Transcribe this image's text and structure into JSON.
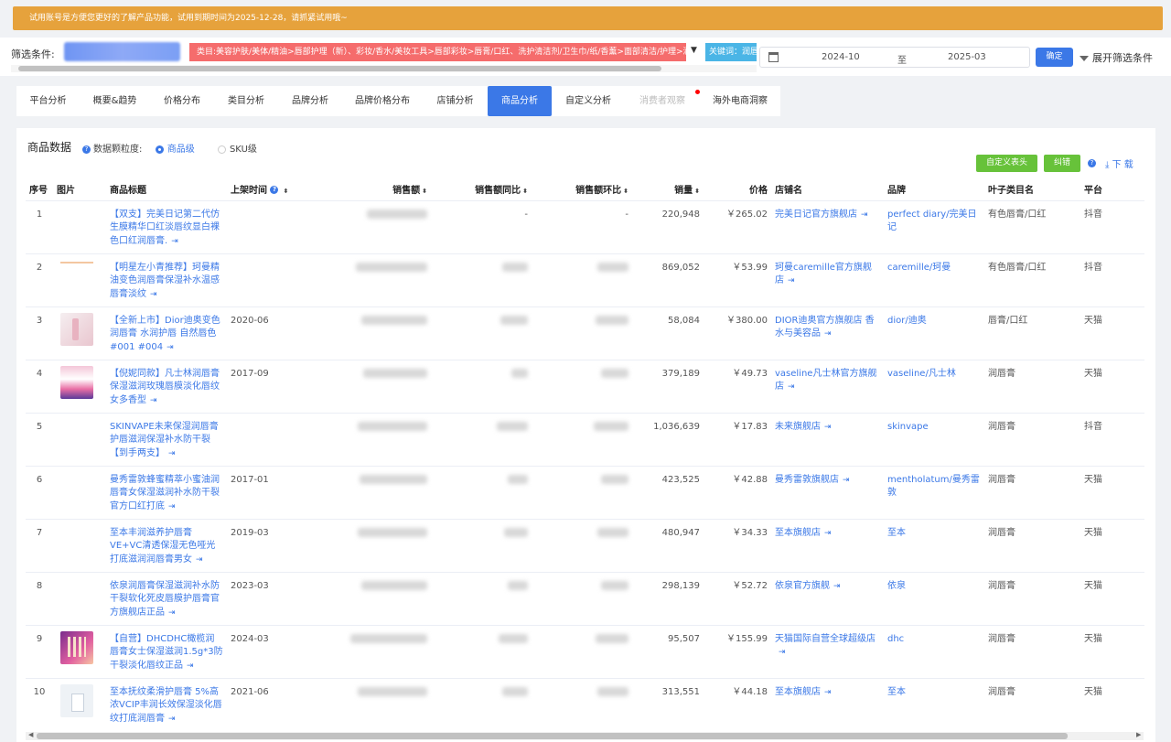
{
  "banner": {
    "text": "试用账号是方便您更好的了解产品功能，试用到期时间为2025-12-28，请抓紧试用哦~"
  },
  "filter": {
    "label": "筛选条件:",
    "category_tag": "类目:美容护肤/美体/精油>唇部护理（新）、彩妆/香水/美妆工具>唇部彩妆>唇膏/口红、洗护清洁剂/卫生巾/纸/香薰>面部清洁/护理>润唇膏",
    "keyword_tag": "关键词：润唇",
    "date_start": "2024-10",
    "date_sep": "至",
    "date_end": "2025-03",
    "confirm_label": "确定",
    "expand_label": "展开筛选条件"
  },
  "tabs": [
    {
      "label": "平台分析",
      "state": "normal"
    },
    {
      "label": "概要&趋势",
      "state": "normal"
    },
    {
      "label": "价格分布",
      "state": "normal"
    },
    {
      "label": "类目分析",
      "state": "normal"
    },
    {
      "label": "品牌分析",
      "state": "normal"
    },
    {
      "label": "品牌价格分布",
      "state": "normal"
    },
    {
      "label": "店铺分析",
      "state": "normal"
    },
    {
      "label": "商品分析",
      "state": "active"
    },
    {
      "label": "自定义分析",
      "state": "normal"
    },
    {
      "label": "消费者观察",
      "state": "disabled"
    },
    {
      "label": "海外电商洞察",
      "state": "normal"
    }
  ],
  "panel": {
    "title": "商品数据",
    "granularity_label": "数据颗粒度:",
    "option_product": "商品级",
    "option_sku": "SKU级",
    "custom_header_btn": "自定义表头",
    "fix_btn": "纠错",
    "download_label": "下 载"
  },
  "columns": {
    "index": "序号",
    "image": "图片",
    "title": "商品标题",
    "launch": "上架时间",
    "sales_amount": "销售额",
    "yoy": "销售额同比",
    "mom": "销售额环比",
    "volume": "销量",
    "price": "价格",
    "store": "店铺名",
    "brand": "品牌",
    "leaf_category": "叶子类目名",
    "platform": "平台"
  },
  "rows": [
    {
      "index": "1",
      "image": "none",
      "title": "【双支】完美日记第二代仿生膜精华口红淡唇纹显白裸色口红润唇膏.",
      "launch": "",
      "yoy": "-",
      "mom": "-",
      "volume": "220,948",
      "price": "￥265.02",
      "store": "完美日记官方旗舰店",
      "brand": "perfect diary/完美日记",
      "leaf": "有色唇膏/口红",
      "platform": "抖音"
    },
    {
      "index": "2",
      "image": "line",
      "title": "【明星左小青推荐】珂曼精油变色润唇膏保湿补水温感唇膏淡纹",
      "launch": "",
      "yoy": "",
      "mom": "",
      "volume": "869,052",
      "price": "￥53.99",
      "store": "珂曼caremille官方旗舰店",
      "brand": "caremille/珂曼",
      "leaf": "有色唇膏/口红",
      "platform": "抖音"
    },
    {
      "index": "3",
      "image": "pink",
      "title": "【全新上市】Dior迪奥变色润唇膏 水润护唇 自然唇色 #001 #004",
      "launch": "2020-06",
      "yoy": "",
      "mom": "",
      "volume": "58,084",
      "price": "￥380.00",
      "store": "DIOR迪奥官方旗舰店 香水与美容品",
      "brand": "dior/迪奥",
      "leaf": "唇膏/口红",
      "platform": "天猫"
    },
    {
      "index": "4",
      "image": "vaseline",
      "title": "【倪妮同款】凡士林润唇膏保湿滋润玫瑰唇膜淡化唇纹女多香型",
      "launch": "2017-09",
      "yoy": "",
      "mom": "",
      "volume": "379,189",
      "price": "￥49.73",
      "store": "vaseline凡士林官方旗舰店",
      "brand": "vaseline/凡士林",
      "leaf": "润唇膏",
      "platform": "天猫"
    },
    {
      "index": "5",
      "image": "none",
      "title": "SKINVAPE未来保湿润唇膏护唇滋润保湿补水防干裂【到手两支】",
      "launch": "",
      "yoy": "",
      "mom": "",
      "volume": "1,036,639",
      "price": "￥17.83",
      "store": "未来旗舰店",
      "brand": "skinvape",
      "leaf": "润唇膏",
      "platform": "抖音"
    },
    {
      "index": "6",
      "image": "none",
      "title": "曼秀雷敦蜂蜜精萃小蜜油润唇膏女保湿滋润补水防干裂官方口红打底",
      "launch": "2017-01",
      "yoy": "",
      "mom": "",
      "volume": "423,525",
      "price": "￥42.88",
      "store": "曼秀雷敦旗舰店",
      "brand": "mentholatum/曼秀雷敦",
      "leaf": "润唇膏",
      "platform": "天猫"
    },
    {
      "index": "7",
      "image": "none",
      "title": "至本丰润滋养护唇膏VE+VC清透保湿无色哑光打底滋润润唇膏男女",
      "launch": "2019-03",
      "yoy": "",
      "mom": "",
      "volume": "480,947",
      "price": "￥34.33",
      "store": "至本旗舰店",
      "brand": "至本",
      "leaf": "润唇膏",
      "platform": "天猫"
    },
    {
      "index": "8",
      "image": "none",
      "title": "依泉润唇膏保湿滋润补水防干裂软化死皮唇膜护唇膏官方旗舰店正品",
      "launch": "2023-03",
      "yoy": "",
      "mom": "",
      "volume": "298,139",
      "price": "￥52.72",
      "store": "依泉官方旗舰",
      "brand": "依泉",
      "leaf": "润唇膏",
      "platform": "天猫"
    },
    {
      "index": "9",
      "image": "purple",
      "title": "【自营】DHCDHC橄榄润唇膏女士保湿滋润1.5g*3防干裂淡化唇纹正品",
      "launch": "2024-03",
      "yoy": "",
      "mom": "",
      "volume": "95,507",
      "price": "￥155.99",
      "store": "天猫国际自营全球超级店",
      "brand": "dhc",
      "leaf": "润唇膏",
      "platform": "天猫"
    },
    {
      "index": "10",
      "image": "white",
      "title": "至本抚纹柔滑护唇膏 5%高浓VCIP丰润长效保湿淡化唇纹打底润唇膏",
      "launch": "2021-06",
      "yoy": "",
      "mom": "",
      "volume": "313,551",
      "price": "￥44.18",
      "store": "至本旗舰店",
      "brand": "至本",
      "leaf": "润唇膏",
      "platform": "天猫"
    }
  ]
}
